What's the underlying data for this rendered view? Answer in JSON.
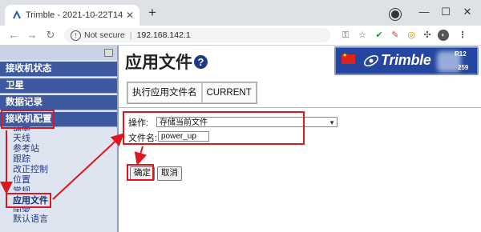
{
  "browser": {
    "tab_title": "Trimble - 2021-10-22T14:22:10Z",
    "tab_close": "✕",
    "new_tab": "+",
    "not_secure": "Not secure",
    "url": "192.168.142.1",
    "window_buttons": [
      "—",
      "☐",
      "✕"
    ],
    "nav_icons": [
      "arrow-left-icon",
      "arrow-right-icon",
      "reload-icon"
    ]
  },
  "sidebar": {
    "sections": [
      {
        "label": "接收机状态"
      },
      {
        "label": "卫星"
      },
      {
        "label": "数据记录"
      },
      {
        "label": "接收机配置"
      }
    ],
    "sub_items": [
      {
        "label": "摘要"
      },
      {
        "label": "天线"
      },
      {
        "label": "参考站"
      },
      {
        "label": "跟踪"
      },
      {
        "label": "改正控制"
      },
      {
        "label": "位置"
      },
      {
        "label": "常规"
      },
      {
        "label": "应用文件",
        "active": true
      },
      {
        "label": "国家"
      },
      {
        "label": "默认语言"
      }
    ]
  },
  "main": {
    "title": "应用文件",
    "help_icon": "?",
    "table": [
      "执行应用文件名",
      "CURRENT"
    ],
    "operation_label": "操作:",
    "operation_value": "存储当前文件",
    "filename_label": "文件名:",
    "filename_value": "power_up",
    "ok_button": "确定",
    "cancel_button": "取消"
  },
  "logo": {
    "brand": "Trimble",
    "model_fragment": "R12",
    "serial_fragment": "259"
  },
  "colors": {
    "sidebar_header": "#3d5aa1",
    "annotation_red": "#e0161e",
    "logo_blue": "#2446a0"
  }
}
